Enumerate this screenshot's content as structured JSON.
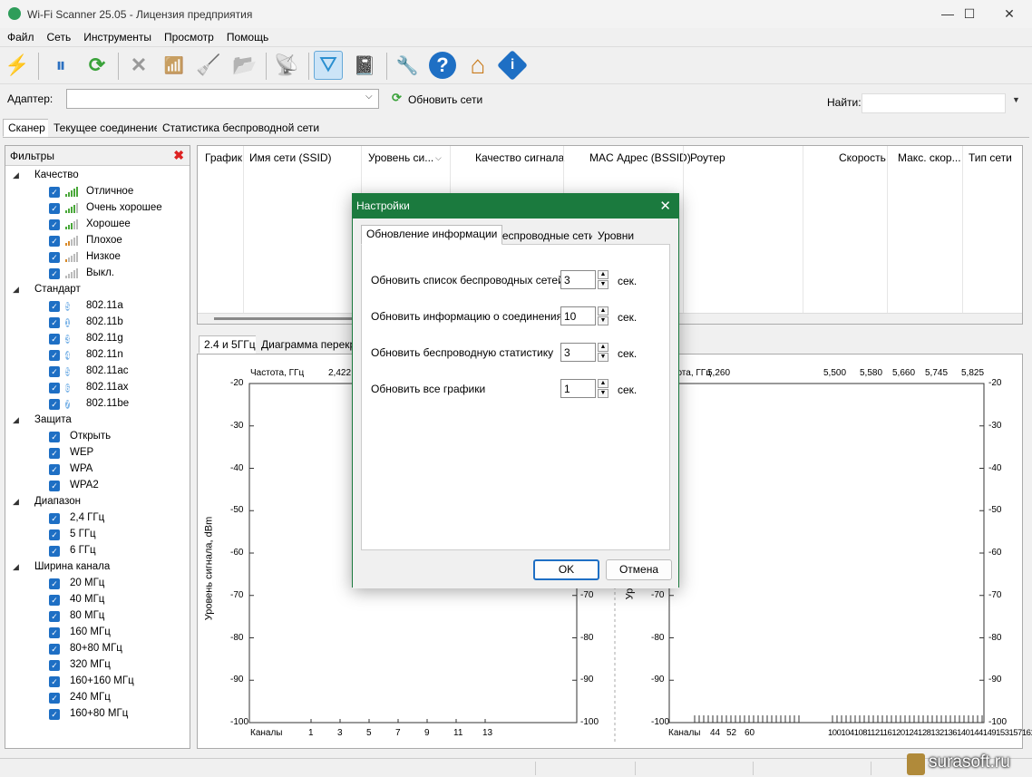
{
  "window": {
    "title": "Wi-Fi Scanner 25.05 - Лицензия предприятия",
    "min": "—",
    "max": "☐",
    "close": "✕"
  },
  "menu": [
    "Файл",
    "Сеть",
    "Инструменты",
    "Просмотр",
    "Помощь"
  ],
  "toolbar": {
    "icons": [
      "lightning-icon",
      "pause-icon",
      "refresh-icon",
      "delete-icon",
      "signal-remove-icon",
      "broom-icon",
      "folder-icon",
      "rss-icon",
      "filter-icon",
      "notebook-icon",
      "wrench-icon",
      "help-icon",
      "home-icon",
      "info-icon"
    ],
    "glyphs": [
      "⚡",
      "⏸",
      "⟳",
      "✕",
      "📶",
      "🧹",
      "📂",
      "📡",
      "⛛",
      "📓",
      "🔧",
      "?",
      "⌂",
      "i"
    ]
  },
  "adapter": {
    "label": "Адаптер:",
    "value": "",
    "refresh_label": "Обновить сети",
    "find_label": "Найти:",
    "find_value": ""
  },
  "main_tabs": [
    "Сканер",
    "Текущее соединение",
    "Статистика беспроводной сети"
  ],
  "filters": {
    "title": "Фильтры",
    "groups": [
      {
        "label": "Качество",
        "items": [
          "Отличное",
          "Очень хорошее",
          "Хорошее",
          "Плохое",
          "Низкое",
          "Выкл."
        ]
      },
      {
        "label": "Стандарт",
        "items": [
          "802.11a",
          "802.11b",
          "802.11g",
          "802.11n",
          "802.11ac",
          "802.11ax",
          "802.11be"
        ],
        "badges": [
          "5",
          "1",
          "3",
          "4",
          "5",
          "6",
          "7"
        ]
      },
      {
        "label": "Защита",
        "items": [
          "Открыть",
          "WEP",
          "WPA",
          "WPA2"
        ]
      },
      {
        "label": "Диапазон",
        "items": [
          "2,4 ГГц",
          "5 ГГц",
          "6 ГГц"
        ]
      },
      {
        "label": "Ширина канала",
        "items": [
          "20 МГц",
          "40 МГц",
          "80 МГц",
          "160 МГц",
          "80+80 МГц",
          "320 МГц",
          "160+160 МГц",
          "240 МГц",
          "160+80 МГц"
        ]
      }
    ]
  },
  "columns": [
    "График",
    "Имя сети (SSID)",
    "Уровень си...",
    "Качество сигнала",
    "MAC Адрес (BSSID)",
    "Роутер",
    "Скорость",
    "Макс. скор...",
    "Тип сети"
  ],
  "graph_tabs": [
    "2.4 и 5ГГц",
    "Диаграмма перекр"
  ],
  "graph_left": {
    "freq_label": "Частота, ГГц",
    "freq_ticks": [
      "2,422"
    ],
    "ylabel": "Уровень сигнала, dBm",
    "y_ticks": [
      "-20",
      "-30",
      "-40",
      "-50",
      "-60",
      "-70",
      "-80",
      "-90",
      "-100"
    ],
    "right_ticks": [
      "-70",
      "-80",
      "-90",
      "-100"
    ],
    "channels_label": "Каналы",
    "channels": [
      "1",
      "3",
      "5",
      "7",
      "9",
      "11",
      "13"
    ]
  },
  "graph_right": {
    "freq_label": "стота, ГГц",
    "freq_ticks": [
      "5,260",
      "5,500",
      "5,580",
      "5,660",
      "5,745",
      "5,825"
    ],
    "ylabel": "Ур",
    "y_ticks": [
      "-70",
      "-80",
      "-90",
      "-100"
    ],
    "right_ticks": [
      "-20",
      "-30",
      "-40",
      "-50",
      "-60",
      "-70",
      "-80",
      "-90",
      "-100"
    ],
    "channels_label": "Каналы",
    "channels_low": [
      "44",
      "52",
      "60"
    ],
    "channels_high": "100104108112116120124128132136140144149153157161165"
  },
  "dialog": {
    "title": "Настройки",
    "tabs": [
      "Обновление информации",
      "Беспроводные сети",
      "Уровни"
    ],
    "rows": [
      {
        "label": "Обновить список беспроводных сетей",
        "value": "3",
        "unit": "сек."
      },
      {
        "label": "Обновить информацию о соединениях",
        "value": "10",
        "unit": "сек."
      },
      {
        "label": "Обновить беспроводную статистику",
        "value": "3",
        "unit": "сек."
      },
      {
        "label": "Обновить все графики",
        "value": "1",
        "unit": "сек."
      }
    ],
    "ok": "OK",
    "cancel": "Отмена"
  },
  "watermark": "surasoft.ru",
  "colors": {
    "accent": "#1b7a3e",
    "checkbox": "#1e6fc4",
    "selection": "#cce4f7"
  }
}
